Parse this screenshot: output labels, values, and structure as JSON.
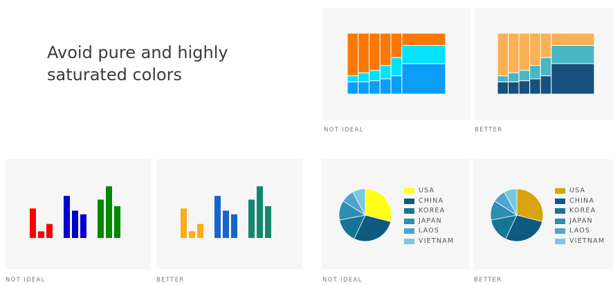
{
  "headline": "Avoid pure and highly saturated colors",
  "captions": {
    "mosaic_not_ideal": "NOT IDEAL",
    "mosaic_better": "BETTER",
    "bars_not_ideal": "NOT IDEAL",
    "bars_better": "BETTER",
    "pie_not_ideal": "NOT IDEAL",
    "pie_better": "BETTER"
  },
  "chart_data": [
    {
      "id": "mosaic_not_ideal",
      "type": "bar",
      "stacked": true,
      "variable_width": true,
      "column_widths": [
        1,
        1,
        1,
        1,
        1,
        4
      ],
      "series": [
        {
          "name": "",
          "values": [
            20,
            20,
            22,
            25,
            30,
            50
          ],
          "color": "#0a9ef8"
        },
        {
          "name": "",
          "values": [
            10,
            15,
            17,
            22,
            30,
            30
          ],
          "color": "#05e2fb"
        },
        {
          "name": "",
          "values": [
            70,
            65,
            61,
            53,
            40,
            20
          ],
          "color": "#fb7806"
        }
      ],
      "ylim": [
        0,
        100
      ],
      "grid": false
    },
    {
      "id": "mosaic_better",
      "type": "bar",
      "stacked": true,
      "variable_width": true,
      "column_widths": [
        1,
        1,
        1,
        1,
        1,
        4
      ],
      "series": [
        {
          "name": "",
          "values": [
            20,
            20,
            22,
            25,
            30,
            50
          ],
          "color": "#17507c"
        },
        {
          "name": "",
          "values": [
            10,
            15,
            17,
            22,
            30,
            30
          ],
          "color": "#47b7c4"
        },
        {
          "name": "",
          "values": [
            70,
            65,
            61,
            53,
            40,
            20
          ],
          "color": "#fab054"
        }
      ],
      "ylim": [
        0,
        100
      ],
      "grid": false
    },
    {
      "id": "bars_not_ideal",
      "type": "bar",
      "grid": false,
      "ylim": [
        0,
        75
      ],
      "groups": [
        {
          "values": [
            40,
            9,
            19
          ],
          "color": "#ff0000"
        },
        {
          "values": [
            57,
            37,
            32
          ],
          "color": "#0000cc"
        },
        {
          "values": [
            52,
            70,
            43
          ],
          "color": "#008800"
        }
      ]
    },
    {
      "id": "bars_better",
      "type": "bar",
      "grid": false,
      "ylim": [
        0,
        75
      ],
      "groups": [
        {
          "values": [
            40,
            9,
            19
          ],
          "color": "#fcac1c"
        },
        {
          "values": [
            57,
            37,
            32
          ],
          "color": "#1765cc"
        },
        {
          "values": [
            52,
            70,
            43
          ],
          "color": "#12876e"
        }
      ]
    },
    {
      "id": "pie_not_ideal",
      "type": "pie",
      "categories": [
        "USA",
        "CHINA",
        "KOREA",
        "JAPAN",
        "LAOS",
        "VIETNAM"
      ],
      "values": [
        29,
        28,
        15,
        12,
        8,
        8
      ],
      "colors": [
        "#ffff18",
        "#0d5a7e",
        "#167596",
        "#2d8db3",
        "#50a3d1",
        "#78c8e0"
      ]
    },
    {
      "id": "pie_better",
      "type": "pie",
      "categories": [
        "USA",
        "CHINA",
        "KOREA",
        "JAPAN",
        "LAOS",
        "VIETNAM"
      ],
      "values": [
        29,
        28,
        15,
        12,
        8,
        8
      ],
      "colors": [
        "#d9a40c",
        "#0d5a7e",
        "#167596",
        "#2d8db3",
        "#50a3d1",
        "#78c8e0"
      ]
    }
  ]
}
